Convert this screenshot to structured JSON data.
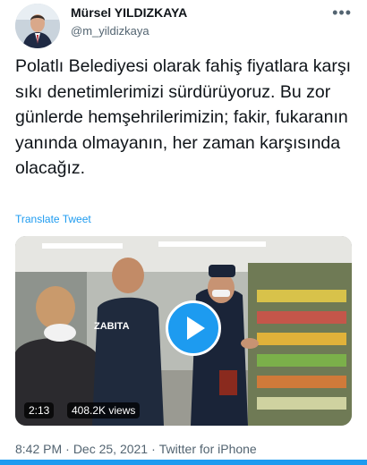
{
  "header": {
    "display_name": "Mürsel YILDIZKAYA",
    "handle": "@m_yildizkaya",
    "more_label": "•••"
  },
  "tweet": {
    "text": "Polatlı Belediyesi olarak fahiş fiyatlara karşı sıkı denetimlerimizi sürdürüyoruz. Bu zor günlerde hemşehrilerimizin; fakir, fukaranın yanında olmayanın, her zaman karşısında olacağız.",
    "translate_label": "Translate Tweet"
  },
  "media": {
    "duration": "2:13",
    "views": "408.2K views",
    "vest_text": "ZABITA"
  },
  "meta": {
    "time": "8:42 PM",
    "date": "Dec 25, 2021",
    "separator": "·",
    "source": "Twitter for iPhone"
  },
  "colors": {
    "accent": "#1d9bf0",
    "text": "#0f1419",
    "secondary": "#536471"
  }
}
